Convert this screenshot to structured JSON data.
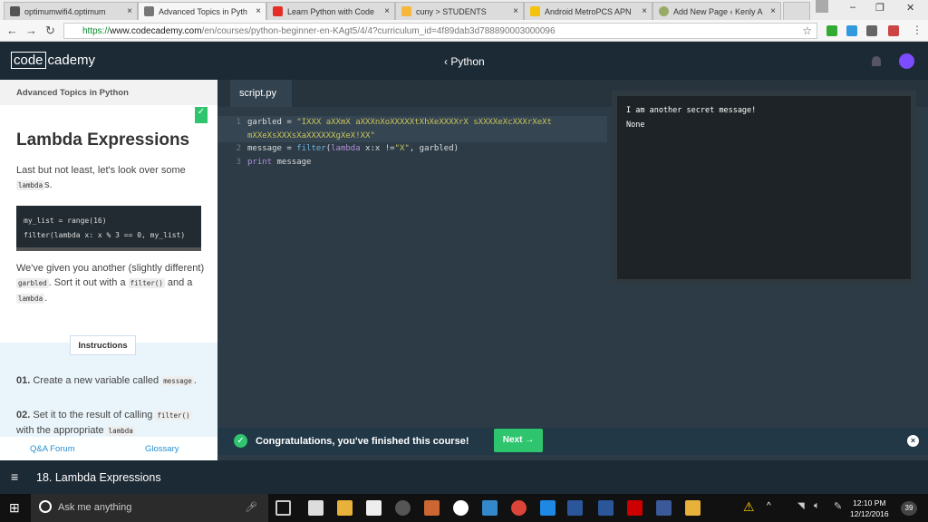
{
  "browser": {
    "tabs": [
      {
        "label": "optimumwifi4.optimum",
        "color": "#555"
      },
      {
        "label": "Advanced Topics in Pyth",
        "color": "#777",
        "active": true
      },
      {
        "label": "Learn Python with Code",
        "color": "#e52d27"
      },
      {
        "label": "cuny > STUDENTS",
        "color": "#f6b73c"
      },
      {
        "label": "Android MetroPCS APN",
        "color": "#f4c20d"
      },
      {
        "label": "Add New Page ‹ Kenly A",
        "color": "#9a6"
      }
    ],
    "url_scheme": "https://",
    "url_host": "www.codecademy.com",
    "url_path": "/en/courses/python-beginner-en-KAgt5/4/4?curriculum_id=4f89dab3d788890003000096"
  },
  "header": {
    "logo_code": "code",
    "logo_rest": "cademy",
    "breadcrumb": "‹ Python"
  },
  "lesson": {
    "section": "Advanced Topics in Python",
    "title": "Lambda Expressions",
    "intro_a": "Last but not least, let's look over some ",
    "intro_code": "lambda",
    "intro_b": "s.",
    "snippet_line1": "my_list = range(16)",
    "snippet_line2": "filter(lambda x: x % 3 == 0, my_list)",
    "body_a": "We've given you another (slightly different) ",
    "body_code1": "garbled",
    "body_b": ". Sort it out with a ",
    "body_code2": "filter()",
    "body_c": " and a ",
    "body_code3": "lambda",
    "body_d": ".",
    "instructions_label": "Instructions",
    "step1_num": "01.",
    "step1_text": " Create a new variable called ",
    "step1_code": "message",
    "step1_end": ".",
    "step2_num": "02.",
    "step2_text": " Set it to the result of calling ",
    "step2_code1": "filter()",
    "step2_text2": " with the appropriate ",
    "step2_code2": "lambda",
    "qa_forum": "Q&A Forum",
    "glossary": "Glossary"
  },
  "editor": {
    "file_tab": "script.py",
    "lines": [
      "1",
      "2",
      "3"
    ],
    "code_line1a": "garbled = ",
    "code_line1b": "\"IXXX aXXmX aXXXnXoXXXXXtXhXeXXXXrX sXXXXeXcXXXrXeXt",
    "code_line1c": "mXXeXsXXXsXaXXXXXXgXeX!XX\"",
    "code_line2a": "message = ",
    "code_line2b": "filter",
    "code_line2c": "(",
    "code_line2d": "lambda",
    "code_line2e": " x:x !=",
    "code_line2f": "\"X\"",
    "code_line2g": ", garbled)",
    "code_line3a": "print",
    "code_line3b": " message",
    "output": "I am another secret message!\nNone"
  },
  "banner": {
    "message": "Congratulations, you've finished this course!",
    "next": "Next →"
  },
  "bottom_bar": {
    "lesson": "18. Lambda Expressions"
  },
  "taskbar": {
    "search_placeholder": "Ask me anything",
    "time": "12:10 PM",
    "date": "12/12/2016",
    "notifications": "39"
  },
  "colors": {
    "brand_dark": "#1c2a35",
    "success": "#2ec56e",
    "link": "#2a8fd0"
  }
}
